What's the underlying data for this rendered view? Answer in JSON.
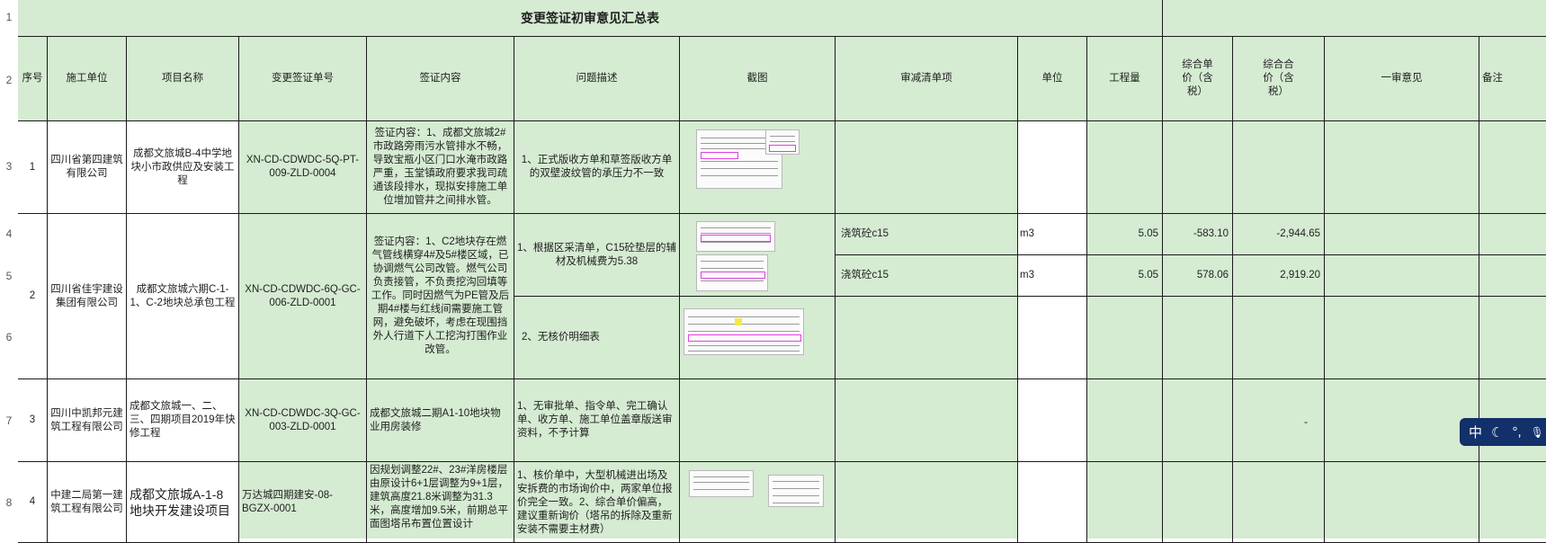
{
  "row_numbers": [
    "1",
    "2",
    "3",
    "4",
    "5",
    "6",
    "7",
    "8"
  ],
  "title": "变更签证初审意见汇总表",
  "headers": {
    "seq": "序号",
    "unit": "施工单位",
    "project": "项目名称",
    "number": "变更签证单号",
    "content": "签证内容",
    "issue": "问题描述",
    "screenshot": "截图",
    "deduction": "审减清单项",
    "uom": "单位",
    "qty": "工程量",
    "unit_price": "综合单价（含税）",
    "total_price": "综合合价（含税）",
    "opinion": "一审意见",
    "remark": "备注"
  },
  "rows": [
    {
      "seq": "1",
      "unit": "四川省第四建筑有限公司",
      "project": "成都文旅城B-4中学地块小市政供应及安装工程",
      "number": "XN-CD-CDWDC-5Q-PT-009-ZLD-0004",
      "content": "签证内容：1、成都文旅城2#市政路旁雨污水管排水不畅，导致宝瓶小区门口水淹市政路严重，玉堂镇政府要求我司疏通该段排水，现拟安排施工单位增加管井之间排水管。",
      "issue": "1、正式版收方单和草签版收方单的双壁波纹管的承压力不一致"
    },
    {
      "seq": "2",
      "unit": "四川省佳宇建设集团有限公司",
      "project": "成都文旅城六期C-1-1、C-2地块总承包工程",
      "number": "XN-CD-CDWDC-6Q-GC-006-ZLD-0001",
      "content": "签证内容：1、C2地块存在燃气管线横穿4#及5#楼区域，已协调燃气公司改管。燃气公司负责接管，不负责挖沟回填等工作。同时因燃气为PE管及后期4#楼与红线间需要施工管网，避免破坏，考虑在现围挡外人行道下人工挖沟打围作业改管。",
      "issue_a": "1、根据区采清单，C15砼垫层的辅材及机械费为5.38",
      "issue_b": "2、无核价明细表",
      "lines": [
        {
          "item": "浇筑砼c15",
          "uom": "m3",
          "qty": "5.05",
          "unit_price": "-583.10",
          "total_price": "-2,944.65"
        },
        {
          "item": "浇筑砼c15",
          "uom": "m3",
          "qty": "5.05",
          "unit_price": "578.06",
          "total_price": "2,919.20"
        }
      ]
    },
    {
      "seq": "3",
      "unit": "四川中凯邦元建筑工程有限公司",
      "project": "成都文旅城一、二、三、四期项目2019年快修工程",
      "number": "XN-CD-CDWDC-3Q-GC-003-ZLD-0001",
      "content": "成都文旅城二期A1-10地块物业用房装修",
      "issue": "1、无审批单、指令单、完工确认单、收方单、施工单位盖章版送审资料，不予计算",
      "total_price": "-"
    },
    {
      "seq": "4",
      "unit": "中建二局第一建筑工程有限公司",
      "project": "成都文旅城A-1-8地块开发建设项目",
      "number": "万达城四期建安-08-BGZX-0001",
      "content": "因规划调整22#、23#洋房楼层由原设计6+1层调整为9+1层，建筑高度21.8米调整为31.3米，高度增加9.5米，前期总平面图塔吊布置位置设计",
      "issue": "1、核价单中，大型机械进出场及安拆费的市场询价中，两家单位报价完全一致。2、综合单价偏高，建议重新询价（塔吊的拆除及重新安装不需要主材费）"
    }
  ],
  "ime_toolbar": {
    "lang": "中",
    "moon_icon": "☾",
    "punct_icon": "°,",
    "mic_icon": "🎙"
  },
  "colors": {
    "sheet_bg": "#d5ebd2",
    "grid": "#1a1a1a",
    "toolbar_bg": "#12306a",
    "highlight": "#e040e0"
  }
}
